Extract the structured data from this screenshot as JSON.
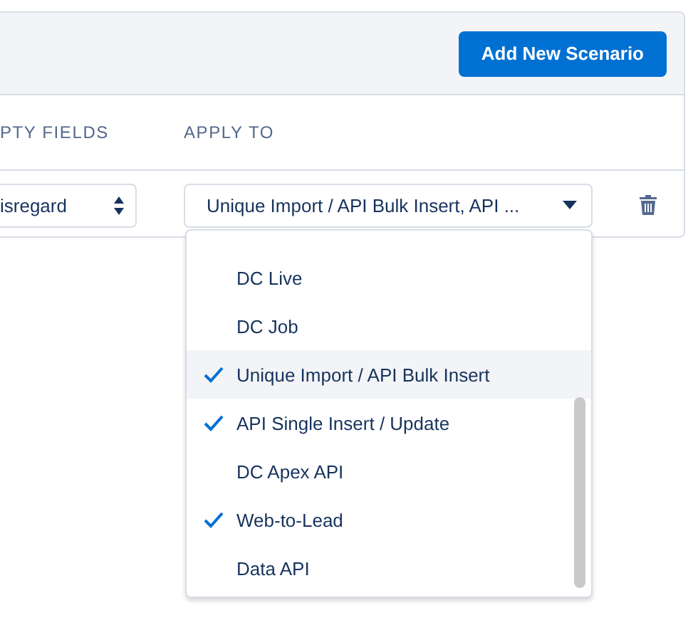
{
  "header": {
    "button": "Add New Scenario"
  },
  "columns": [
    "PTY FIELDS",
    "APPLY TO"
  ],
  "row": {
    "select_value": "isregard",
    "apply_to_value": "Unique Import / API Bulk Insert, API ..."
  },
  "menu": {
    "items": [
      {
        "label": "DC Live",
        "checked": false,
        "highlighted": false
      },
      {
        "label": "DC Job",
        "checked": false,
        "highlighted": false
      },
      {
        "label": "Unique Import / API Bulk Insert",
        "checked": true,
        "highlighted": true
      },
      {
        "label": "API Single Insert / Update",
        "checked": true,
        "highlighted": false
      },
      {
        "label": "DC Apex API",
        "checked": false,
        "highlighted": false
      },
      {
        "label": "Web-to-Lead",
        "checked": true,
        "highlighted": false
      },
      {
        "label": "Data API",
        "checked": false,
        "highlighted": false
      }
    ]
  }
}
